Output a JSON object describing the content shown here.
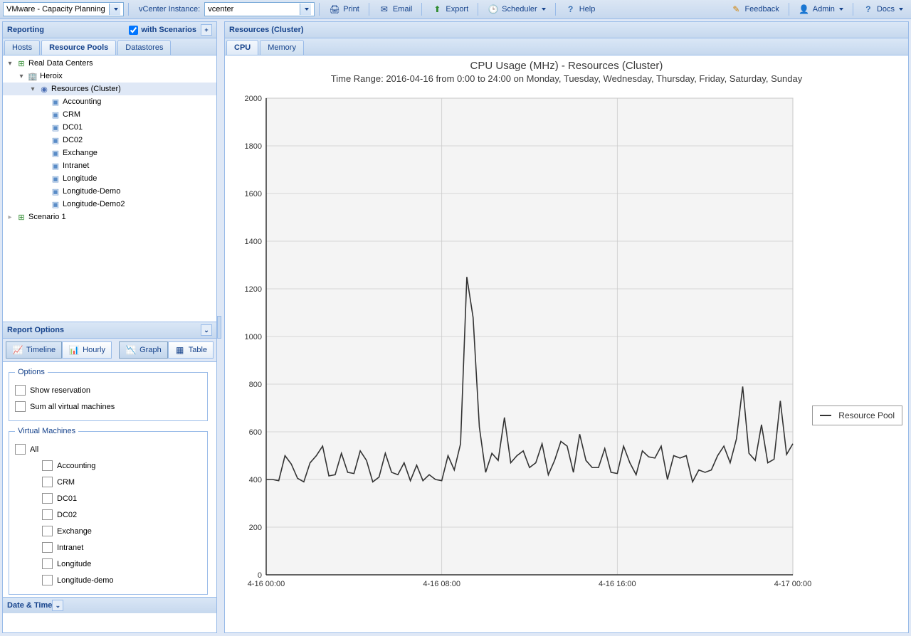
{
  "toolbar": {
    "app": "VMware - Capacity Planning",
    "vcenter_label": "vCenter Instance:",
    "vcenter_value": "vcenter",
    "print": "Print",
    "email": "Email",
    "export": "Export",
    "scheduler": "Scheduler",
    "help": "Help",
    "feedback": "Feedback",
    "admin": "Admin",
    "docs": "Docs"
  },
  "left": {
    "reporting": "Reporting",
    "with_scenarios": "with Scenarios",
    "tabs": {
      "hosts": "Hosts",
      "resource_pools": "Resource Pools",
      "datastores": "Datastores"
    },
    "tree": {
      "root": "Real Data Centers",
      "heroix": "Heroix",
      "resources": "Resources (Cluster)",
      "children": [
        "Accounting",
        "CRM",
        "DC01",
        "DC02",
        "Exchange",
        "Intranet",
        "Longitude",
        "Longitude-Demo",
        "Longitude-Demo2"
      ],
      "scenario": "Scenario 1"
    },
    "report_options": "Report Options",
    "buttons": {
      "timeline": "Timeline",
      "hourly": "Hourly",
      "graph": "Graph",
      "table": "Table"
    },
    "options_group": "Options",
    "opt_show_reservation": "Show reservation",
    "opt_sum_vm": "Sum all virtual machines",
    "vm_group": "Virtual Machines",
    "vm_all": "All",
    "vms": [
      "Accounting",
      "CRM",
      "DC01",
      "DC02",
      "Exchange",
      "Intranet",
      "Longitude",
      "Longitude-demo"
    ],
    "date_time": "Date & Time"
  },
  "right": {
    "title": "Resources (Cluster)",
    "tabs": {
      "cpu": "CPU",
      "memory": "Memory"
    },
    "legend": "Resource Pool"
  },
  "chart_data": {
    "type": "line",
    "title": "CPU Usage (MHz) - Resources (Cluster)",
    "subtitle": "Time Range: 2016-04-16 from 0:00 to 24:00 on Monday, Tuesday, Wednesday, Thursday, Friday, Saturday, Sunday",
    "ylabel": "",
    "xlabel": "",
    "ylim": [
      0,
      2000
    ],
    "yticks": [
      0,
      200,
      400,
      600,
      800,
      1000,
      1200,
      1400,
      1600,
      1800,
      2000
    ],
    "xticks": [
      "4-16 00:00",
      "4-16 08:00",
      "4-16 16:00",
      "4-17 00:00"
    ],
    "series": [
      {
        "name": "Resource Pool",
        "values": [
          400,
          400,
          395,
          500,
          465,
          405,
          390,
          470,
          500,
          540,
          415,
          420,
          510,
          430,
          425,
          520,
          480,
          390,
          410,
          510,
          430,
          420,
          470,
          395,
          460,
          395,
          420,
          400,
          395,
          500,
          440,
          550,
          1250,
          1080,
          620,
          430,
          510,
          480,
          660,
          470,
          500,
          520,
          450,
          470,
          550,
          420,
          480,
          560,
          540,
          430,
          590,
          480,
          450,
          450,
          530,
          430,
          425,
          540,
          470,
          420,
          520,
          495,
          490,
          540,
          400,
          500,
          490,
          500,
          390,
          440,
          430,
          440,
          500,
          540,
          470,
          570,
          790,
          510,
          480,
          630,
          470,
          485,
          730,
          505,
          550
        ]
      }
    ]
  }
}
